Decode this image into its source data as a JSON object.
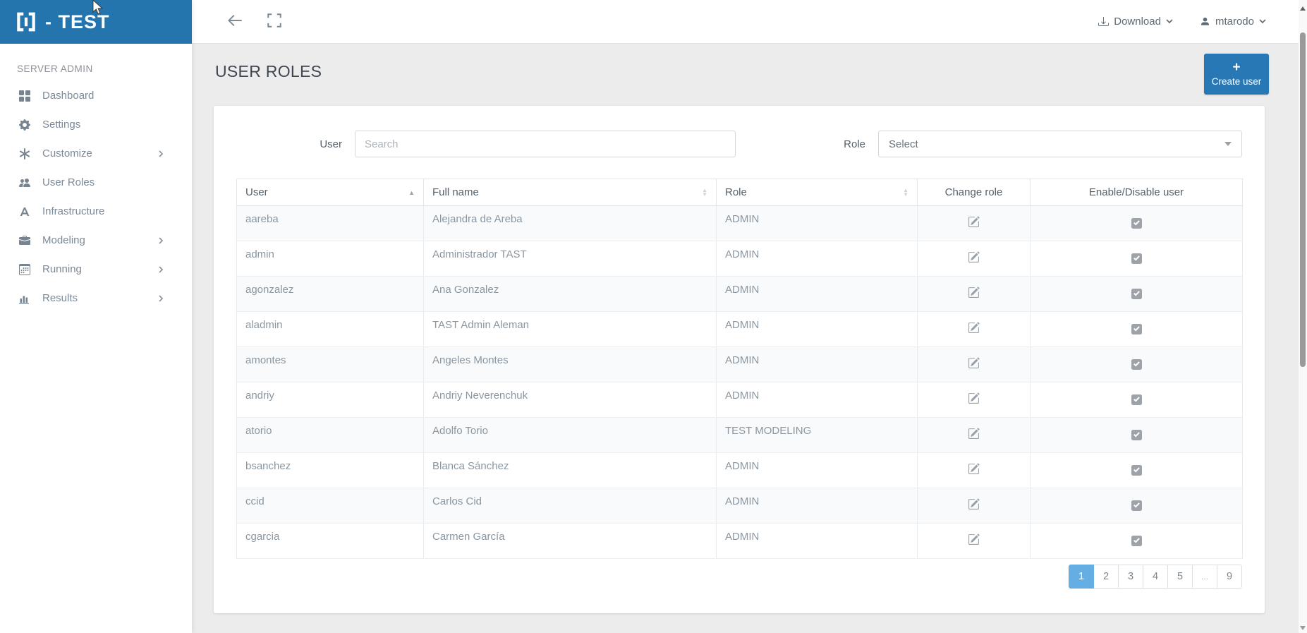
{
  "colors": {
    "brand": "#2474ad",
    "button": "#2878b5",
    "page_active": "#64aee3",
    "checkbox": "#9da3a8"
  },
  "app": {
    "logo_text": "- TEST"
  },
  "sidebar": {
    "section_label": "SERVER ADMIN",
    "items": [
      {
        "label": "Dashboard",
        "icon": "dashboard-icon",
        "has_submenu": false
      },
      {
        "label": "Settings",
        "icon": "gear-icon",
        "has_submenu": false
      },
      {
        "label": "Customize",
        "icon": "asterisk-icon",
        "has_submenu": true
      },
      {
        "label": "User Roles",
        "icon": "users-icon",
        "has_submenu": false
      },
      {
        "label": "Infrastructure",
        "icon": "infrastructure-icon",
        "has_submenu": false
      },
      {
        "label": "Modeling",
        "icon": "briefcase-icon",
        "has_submenu": true
      },
      {
        "label": "Running",
        "icon": "calendar-icon",
        "has_submenu": true
      },
      {
        "label": "Results",
        "icon": "bar-chart-icon",
        "has_submenu": true
      }
    ]
  },
  "topbar": {
    "download_label": "Download",
    "username": "mtarodo"
  },
  "page": {
    "title": "USER ROLES",
    "create_user_label": "Create user",
    "create_user_plus": "+"
  },
  "filters": {
    "user_label": "User",
    "user_placeholder": "Search",
    "user_value": "",
    "role_label": "Role",
    "role_value": "Select"
  },
  "table": {
    "columns": [
      "User",
      "Full name",
      "Role",
      "Change role",
      "Enable/Disable user"
    ],
    "rows": [
      {
        "user": "aareba",
        "full_name": "Alejandra de Areba",
        "role": "ADMIN",
        "enabled": true
      },
      {
        "user": "admin",
        "full_name": "Administrador TAST",
        "role": "ADMIN",
        "enabled": true
      },
      {
        "user": "agonzalez",
        "full_name": "Ana Gonzalez",
        "role": "ADMIN",
        "enabled": true
      },
      {
        "user": "aladmin",
        "full_name": "TAST Admin Aleman",
        "role": "ADMIN",
        "enabled": true
      },
      {
        "user": "amontes",
        "full_name": "Angeles Montes",
        "role": "ADMIN",
        "enabled": true
      },
      {
        "user": "andriy",
        "full_name": "Andriy Neverenchuk",
        "role": "ADMIN",
        "enabled": true
      },
      {
        "user": "atorio",
        "full_name": "Adolfo Torio",
        "role": "TEST MODELING",
        "enabled": true
      },
      {
        "user": "bsanchez",
        "full_name": "Blanca Sánchez",
        "role": "ADMIN",
        "enabled": true
      },
      {
        "user": "ccid",
        "full_name": "Carlos Cid",
        "role": "ADMIN",
        "enabled": true
      },
      {
        "user": "cgarcia",
        "full_name": "Carmen García",
        "role": "ADMIN",
        "enabled": true
      }
    ]
  },
  "pagination": {
    "pages": [
      "1",
      "2",
      "3",
      "4",
      "5",
      "...",
      "9"
    ],
    "active_page": "1"
  }
}
